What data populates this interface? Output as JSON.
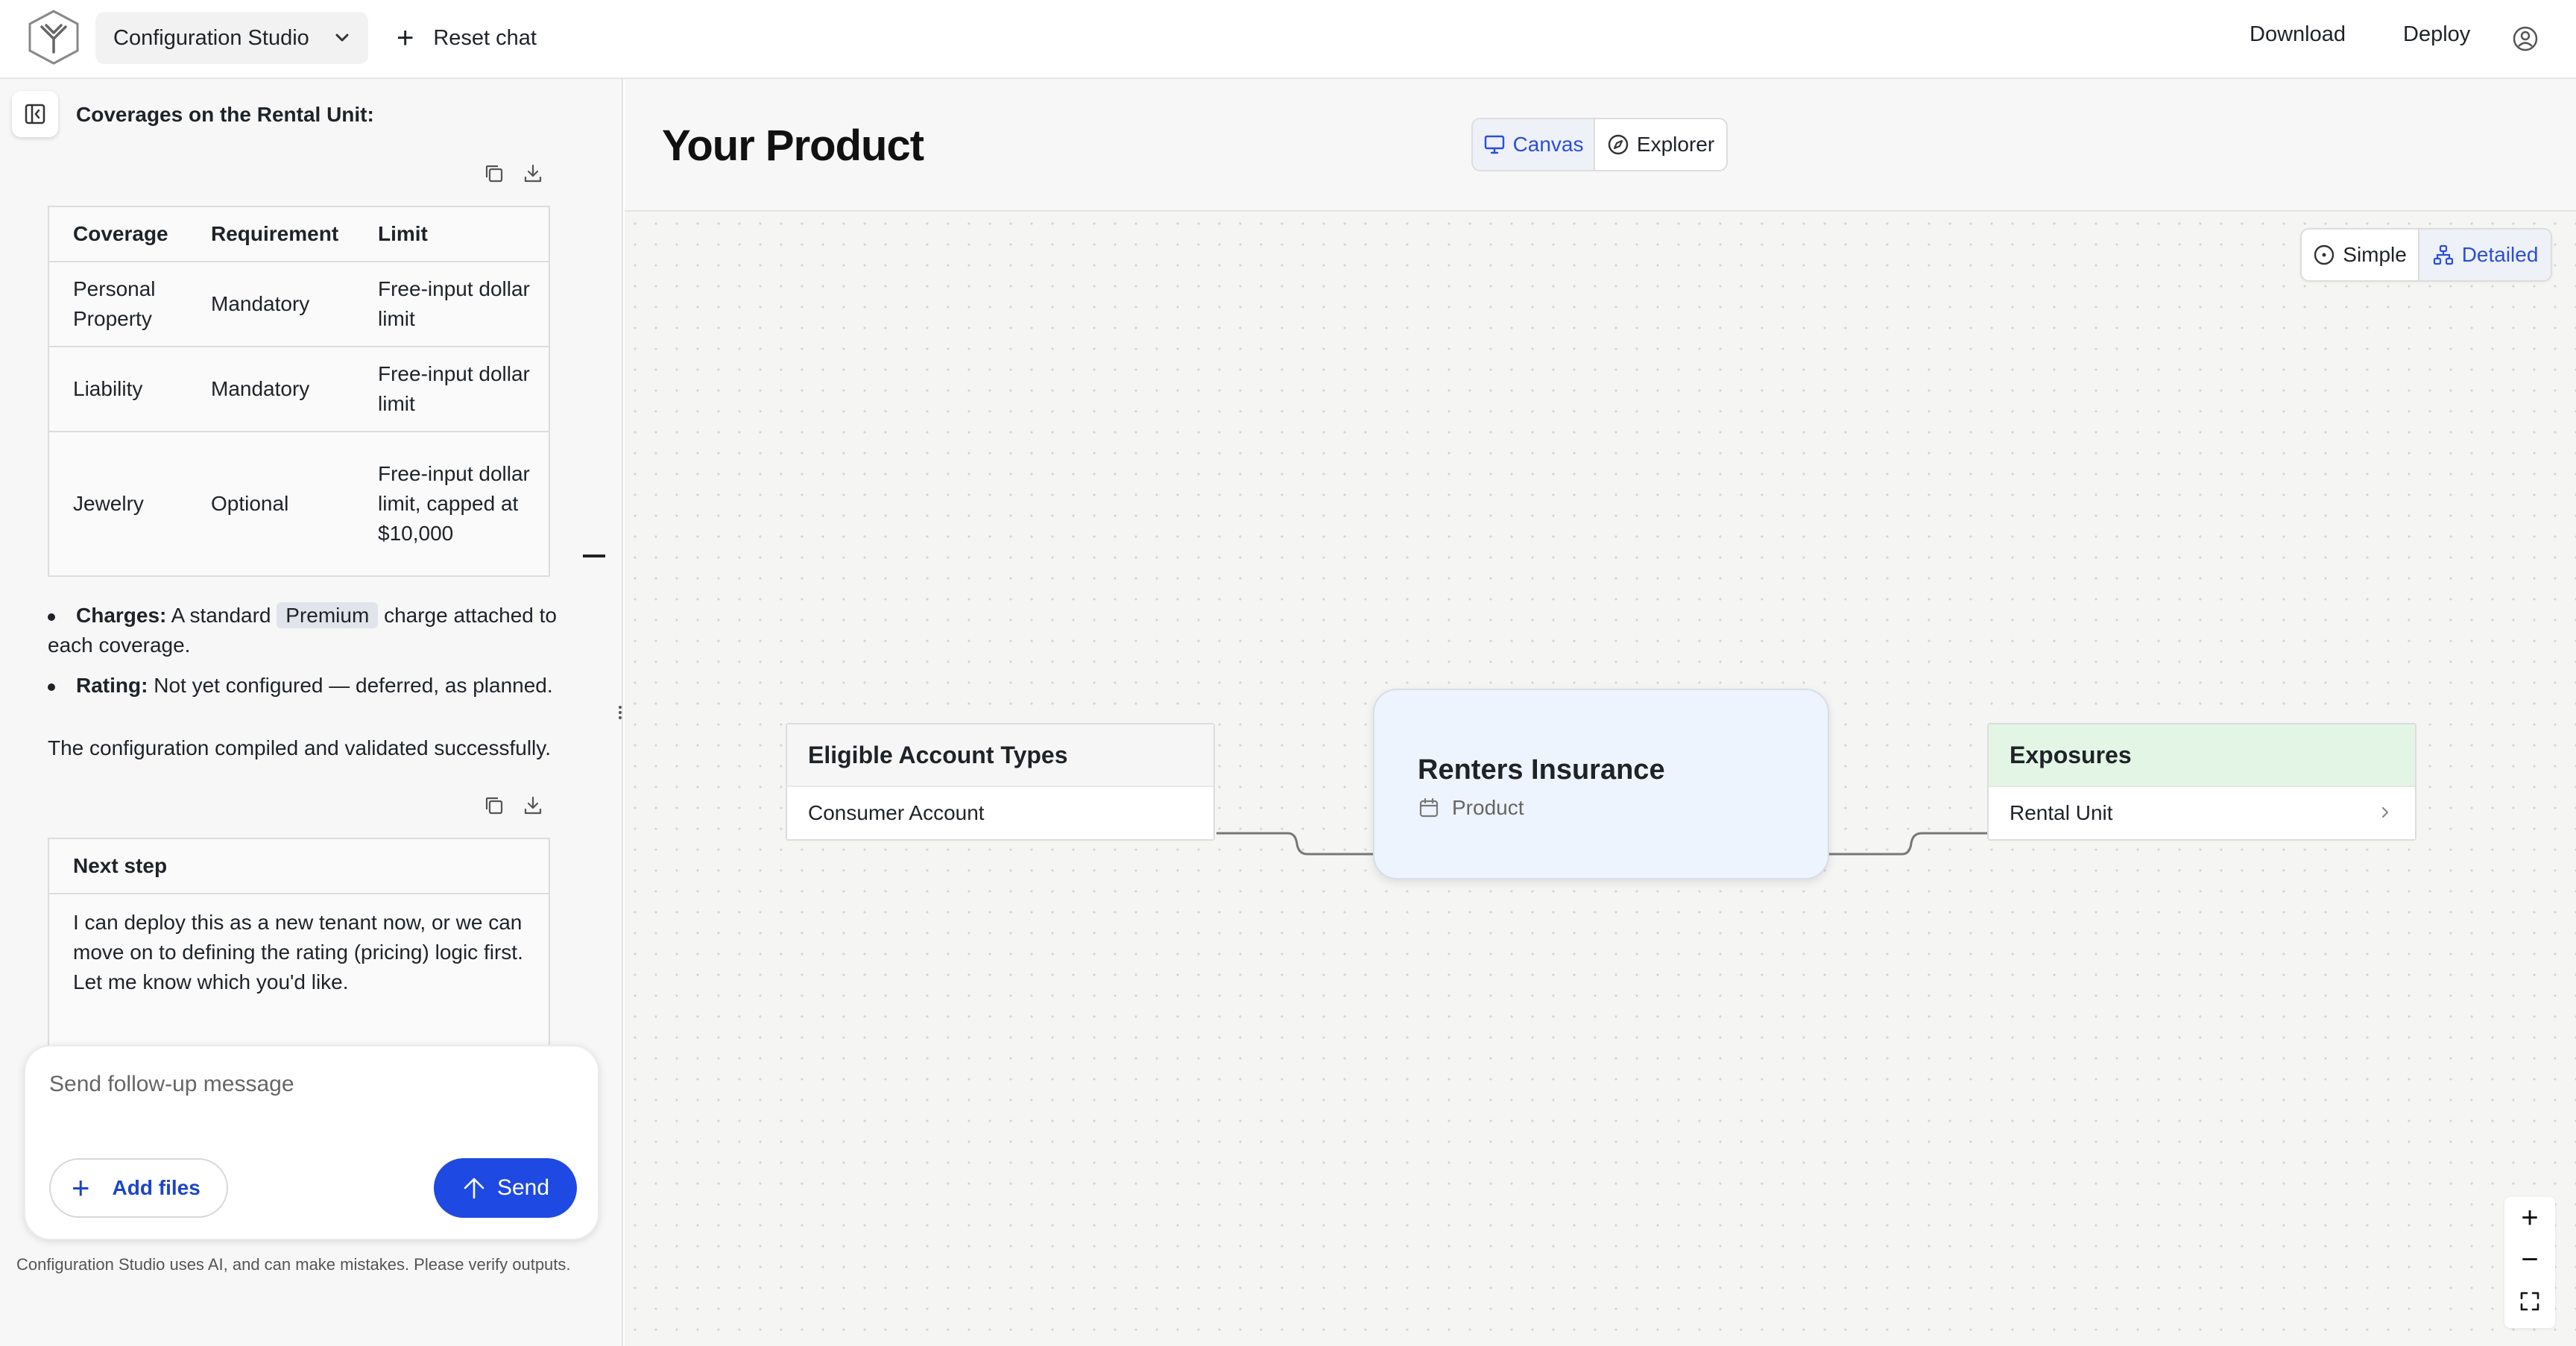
{
  "topbar": {
    "studio_name": "Configuration Studio",
    "reset_label": "Reset chat",
    "download_label": "Download",
    "deploy_label": "Deploy"
  },
  "chat": {
    "coverage_heading": "Coverages on the Rental Unit:",
    "table": {
      "headers": [
        "Coverage",
        "Requirement",
        "Limit"
      ],
      "rows": [
        [
          "Personal Property",
          "Mandatory",
          "Free-input dollar limit"
        ],
        [
          "Liability",
          "Mandatory",
          "Free-input dollar limit"
        ],
        [
          "Jewelry",
          "Optional",
          "Free-input dollar limit, capped at $10,000"
        ]
      ]
    },
    "bullets": {
      "charges_label": "Charges:",
      "charges_pre": "A standard",
      "charges_tag": "Premium",
      "charges_post": "charge attached to each coverage.",
      "rating_label": "Rating:",
      "rating_text": "Not yet configured — deferred, as planned."
    },
    "compile_message": "The configuration compiled and validated successfully.",
    "next_step": {
      "title": "Next step",
      "body": "I can deploy this as a new tenant now, or we can move on to defining the rating (pricing) logic first. Let me know which you'd like."
    },
    "composer": {
      "placeholder": "Send follow-up message",
      "add_files_label": "Add files",
      "send_label": "Send"
    },
    "disclaimer": "Configuration Studio uses AI, and can make mistakes. Please verify outputs."
  },
  "canvas": {
    "title": "Your Product",
    "view_tabs": {
      "canvas": "Canvas",
      "explorer": "Explorer",
      "active": "canvas"
    },
    "detail_tabs": {
      "simple": "Simple",
      "detailed": "Detailed",
      "active": "detailed"
    },
    "nodes": {
      "accounts": {
        "title": "Eligible Account Types",
        "items": [
          "Consumer Account"
        ]
      },
      "product": {
        "name": "Renters Insurance",
        "type": "Product"
      },
      "exposures": {
        "title": "Exposures",
        "items": [
          "Rental Unit"
        ]
      }
    },
    "zoom": {
      "in": "+",
      "out": "−"
    }
  },
  "colors": {
    "accent": "#1e49e2",
    "accent_text": "#2a4fd8",
    "product_node_bg": "#eef4fd",
    "exposure_head_bg": "#e3f6e6"
  },
  "icons": [
    "logo-icon",
    "chevron-down-icon",
    "plus-icon",
    "user-circle-icon",
    "sidebar-collapse-icon",
    "copy-icon",
    "download-icon",
    "monitor-icon",
    "compass-icon",
    "circle-dot-icon",
    "hierarchy-icon",
    "calendar-icon",
    "chevron-right-icon",
    "arrow-up-icon",
    "fit-view-icon",
    "drag-handle-icon"
  ]
}
